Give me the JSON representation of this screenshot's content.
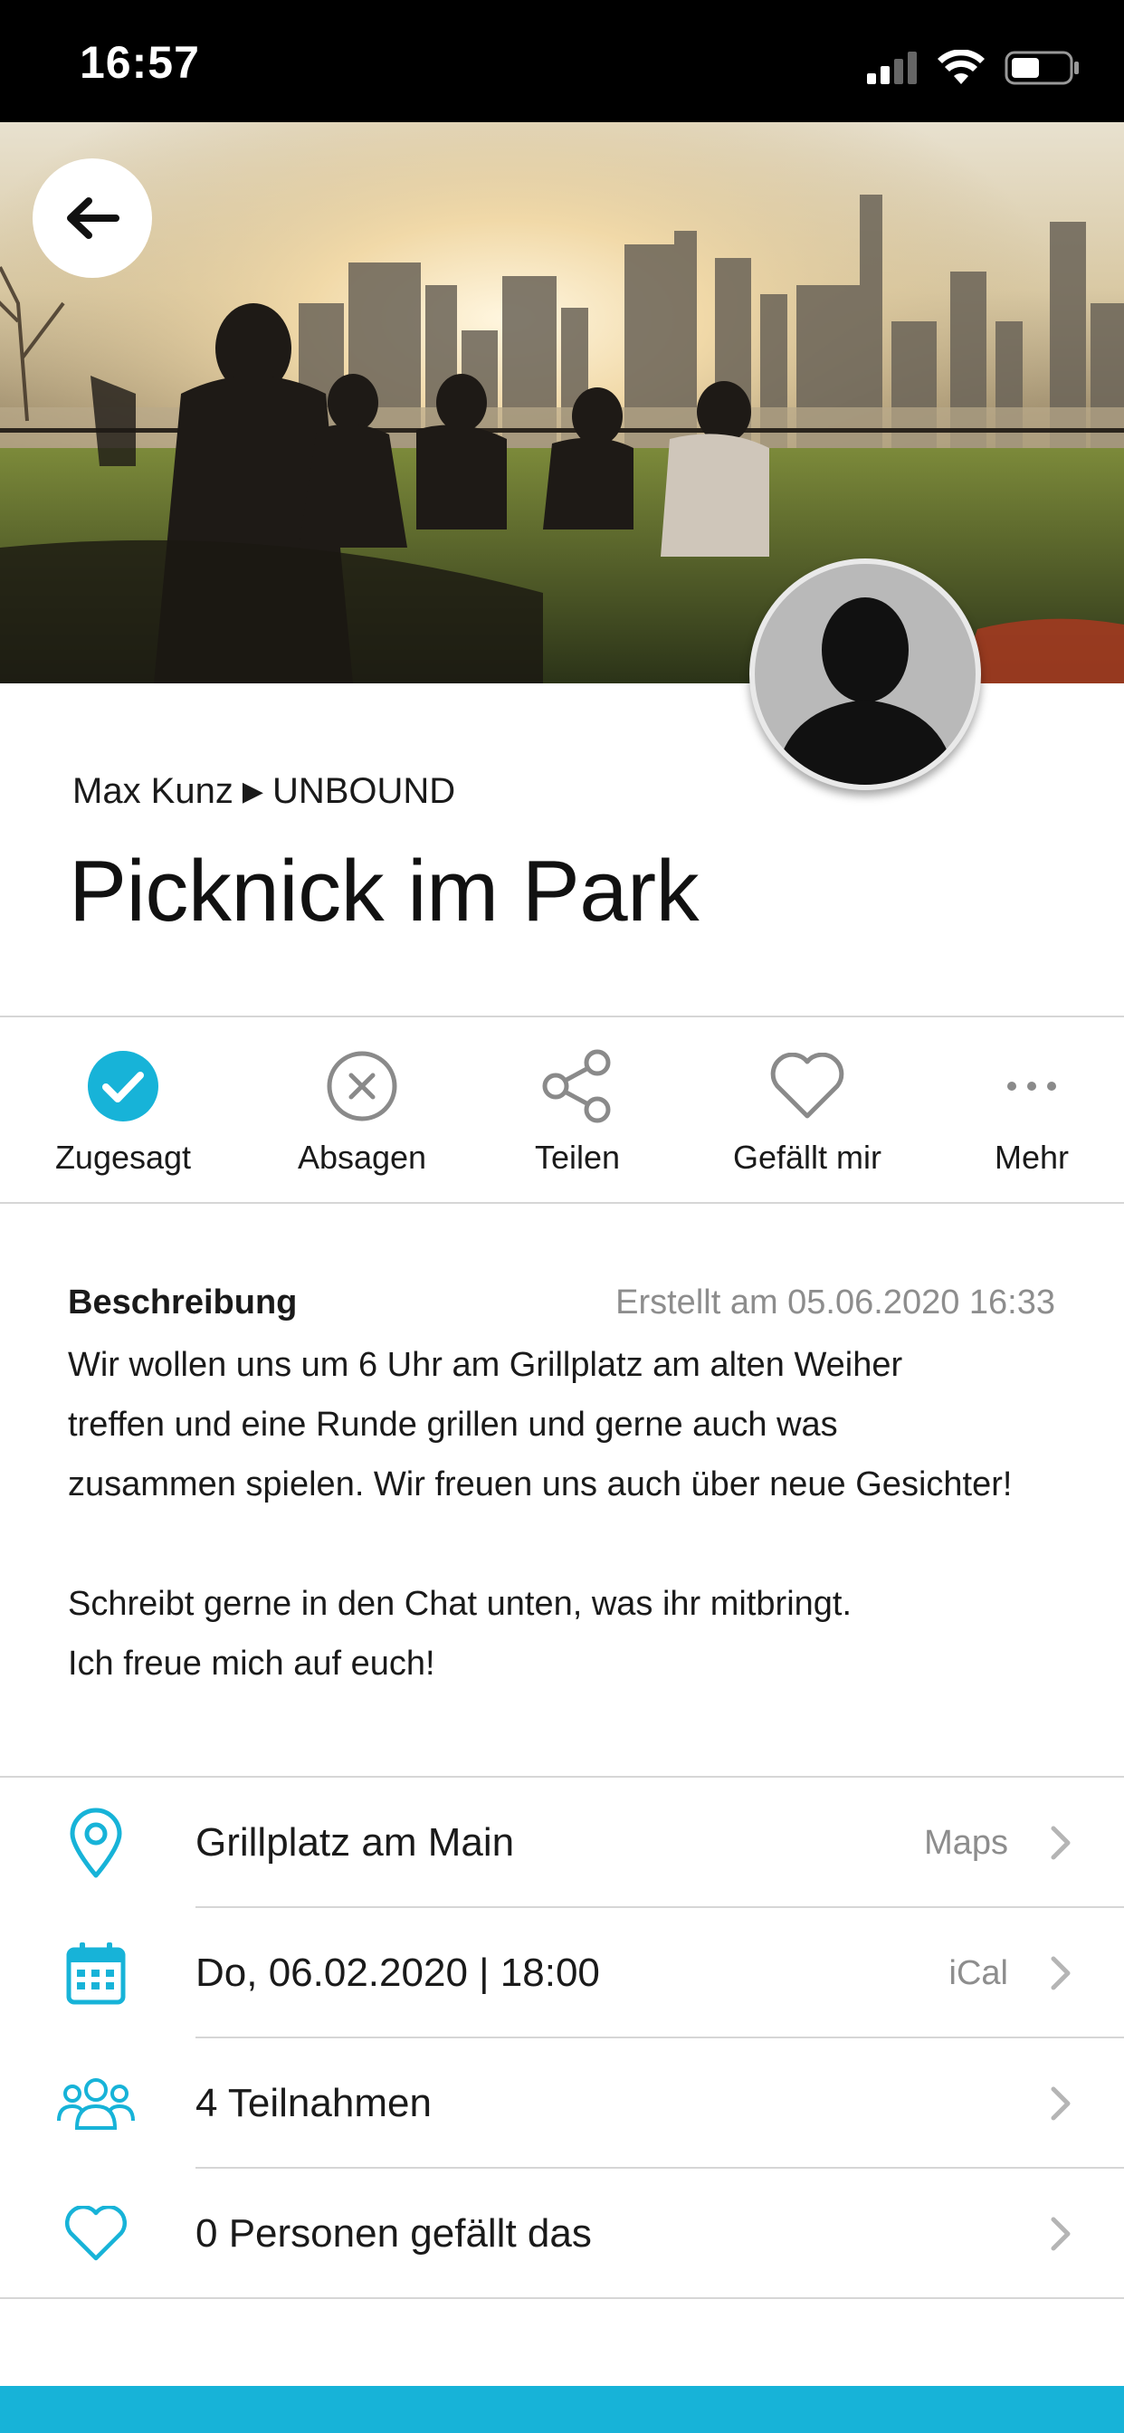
{
  "status_bar": {
    "time": "16:57"
  },
  "header": {
    "author": "Max Kunz",
    "group": "UNBOUND",
    "title": "Picknick im Park"
  },
  "actions": [
    {
      "label": "Zugesagt",
      "icon": "check-circle-filled-icon"
    },
    {
      "label": "Absagen",
      "icon": "x-circle-icon"
    },
    {
      "label": "Teilen",
      "icon": "share-icon"
    },
    {
      "label": "Gefällt mir",
      "icon": "heart-icon"
    },
    {
      "label": "Mehr",
      "icon": "more-dots-icon"
    }
  ],
  "description": {
    "heading": "Beschreibung",
    "created": "Erstellt am 05.06.2020 16:33",
    "paragraph1": "Wir wollen uns um 6 Uhr am Grillplatz am alten Weiher\ntreffen und eine Runde grillen und gerne auch was\nzusammen spielen. Wir freuen uns auch über neue Gesichter!",
    "paragraph2": "Schreibt gerne in den Chat unten, was ihr mitbringt.\nIch freue mich auf euch!"
  },
  "info_rows": [
    {
      "text": "Grillplatz am Main",
      "link": "Maps",
      "icon": "location-pin-icon"
    },
    {
      "text": "Do, 06.02.2020 | 18:00",
      "link": "iCal",
      "icon": "calendar-icon"
    },
    {
      "text": "4 Teilnahmen",
      "link": "",
      "icon": "group-icon"
    },
    {
      "text": "0 Personen gefällt das",
      "link": "",
      "icon": "heart-icon"
    }
  ],
  "colors": {
    "accent": "#17b3d8",
    "gray_text": "#8d8d8d",
    "icon_gray": "#8a8a8a"
  }
}
